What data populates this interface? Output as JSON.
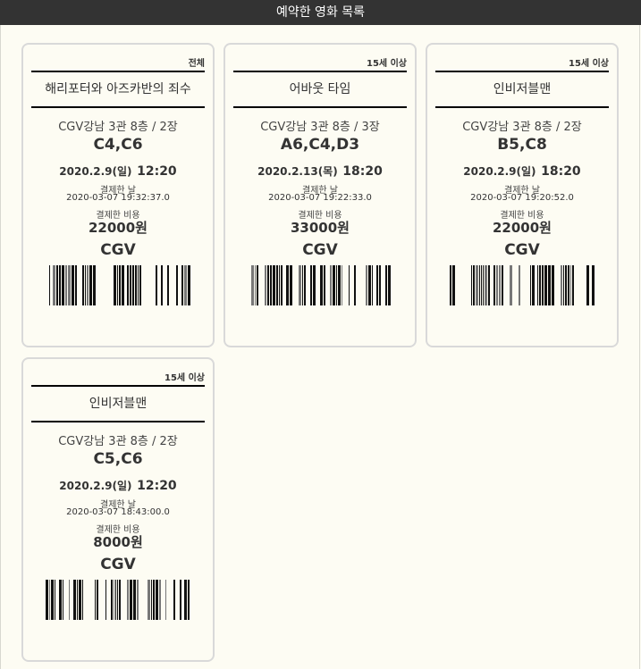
{
  "header": {
    "title": "예약한 영화 목록"
  },
  "tickets": [
    {
      "rating": "전체",
      "title": "해리포터와 아즈카반의 죄수",
      "venue": "CGV강남 3관 8층 / 2장",
      "seats": "C4,C6",
      "show_date": "2020.2.9(일)",
      "show_time": "12:20",
      "paid_label": "결제한 날",
      "paid_at": "2020-03-07 19:32:37.0",
      "cost_label": "결제한 비용",
      "price": "22000원",
      "brand": "CGV"
    },
    {
      "rating": "15세 이상",
      "title": "어바웃 타임",
      "venue": "CGV강남 3관 8층 / 3장",
      "seats": "A6,C4,D3",
      "show_date": "2020.2.13(목)",
      "show_time": "18:20",
      "paid_label": "결제한 날",
      "paid_at": "2020-03-07 19:22:33.0",
      "cost_label": "결제한 비용",
      "price": "33000원",
      "brand": "CGV"
    },
    {
      "rating": "15세 이상",
      "title": "인비저블맨",
      "venue": "CGV강남 3관 8층 / 2장",
      "seats": "B5,C8",
      "show_date": "2020.2.9(일)",
      "show_time": "18:20",
      "paid_label": "결제한 날",
      "paid_at": "2020-03-07 19:20:52.0",
      "cost_label": "결제한 비용",
      "price": "22000원",
      "brand": "CGV"
    },
    {
      "rating": "15세 이상",
      "title": "인비저블맨",
      "venue": "CGV강남 3관 8층 / 2장",
      "seats": "C5,C6",
      "show_date": "2020.2.9(일)",
      "show_time": "12:20",
      "paid_label": "결제한 날",
      "paid_at": "2020-03-07 18:43:00.0",
      "cost_label": "결제한 비용",
      "price": "8000원",
      "brand": "CGV"
    }
  ]
}
